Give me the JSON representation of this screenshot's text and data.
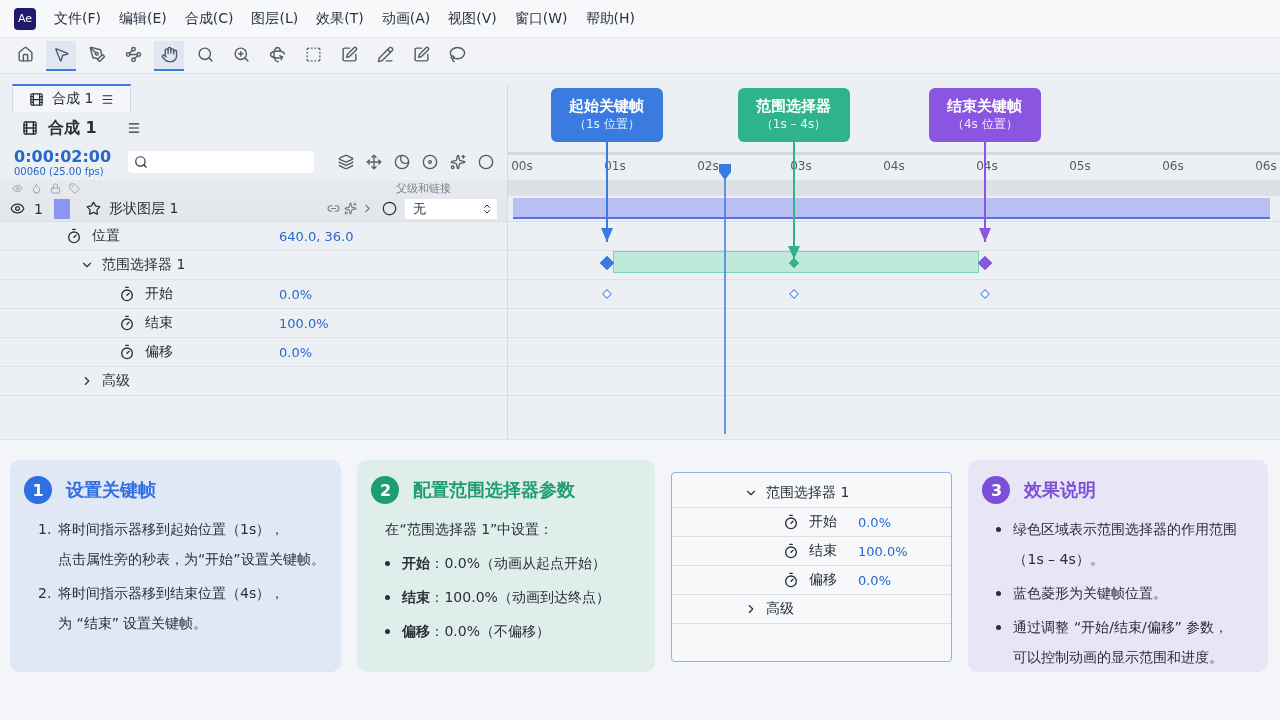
{
  "menu_bar": {
    "logo": "Ae",
    "items": [
      "文件(F)",
      "编辑(E)",
      "合成(C)",
      "图层(L)",
      "效果(T)",
      "动画(A)",
      "视图(V)",
      "窗口(W)",
      "帮助(H)"
    ]
  },
  "toolbar": {
    "tools": [
      {
        "selected": false
      },
      {
        "selected": true
      },
      {
        "selected": false
      },
      {
        "selected": false
      },
      {
        "selected": true
      },
      {
        "selected": false
      },
      {
        "selected": false
      },
      {
        "selected": false
      },
      {
        "selected": false
      },
      {
        "selected": false
      },
      {
        "selected": false
      },
      {
        "selected": false
      },
      {
        "selected": false
      }
    ]
  },
  "panel_tab": {
    "label": "合成 1",
    "selected": true
  },
  "composition": {
    "name": "合成 1",
    "timecode": "0:00:02:00",
    "frame_info": "00060 (25.00 fps)"
  },
  "layer_columns": {
    "parent": "父级和链接"
  },
  "layers": [
    {
      "number": "1",
      "name": "形状图层 1",
      "color": "#8c95f2",
      "parent": "无",
      "visible": true
    }
  ],
  "properties": [
    {
      "kind": "property",
      "name": "位置",
      "value": "640.0, 36.0"
    },
    {
      "kind": "group",
      "name": "范围选择器 1",
      "expanded": true,
      "children": [
        {
          "kind": "property",
          "name": "开始",
          "value": "0.0%"
        },
        {
          "kind": "property",
          "name": "结束",
          "value": "100.0%"
        },
        {
          "kind": "property",
          "name": "偏移",
          "value": "0.0%"
        }
      ]
    },
    {
      "kind": "group",
      "name": "高级",
      "expanded": false
    }
  ],
  "timeline": {
    "ruler": [
      "00s",
      "01s",
      "02s",
      "03s",
      "04s",
      "04s",
      "05s",
      "06s",
      "06s"
    ],
    "playhead": {
      "level": 0.273
    },
    "callouts": [
      {
        "title": "起始关键帧",
        "subtitle": "（1s 位置）",
        "color": "#3a7be0",
        "level": 0.114
      },
      {
        "title": "范围选择器",
        "subtitle": "（1s – 4s）",
        "color": "#2fb38a",
        "level": 0.365
      },
      {
        "title": "结束关键帧",
        "subtitle": "（4s 位置）",
        "color": "#8a55e0",
        "level": 0.622
      }
    ]
  },
  "cards": [
    {
      "kind": "numbered",
      "number": "1",
      "title": "设置关键帧",
      "color": "#2f6fdf",
      "items": [
        {
          "marker": "1.",
          "lines": [
            "将时间指示器移到起始位置（1s），",
            "点击属性旁的秒表，为“开始”设置关键帧。"
          ]
        },
        {
          "marker": "2.",
          "lines": [
            "将时间指示器移到结束位置（4s），",
            "为 “结束” 设置关键帧。"
          ]
        }
      ]
    },
    {
      "kind": "bulleted",
      "number": "2",
      "title": "配置范围选择器参数",
      "color": "#1f9d72",
      "intro": "在“范围选择器 1”中设置：",
      "items": [
        {
          "lines": [
            "**开始**：0.0%（动画从起点开始）"
          ]
        },
        {
          "lines": [
            "**结束**：100.0%（动画到达终点）"
          ]
        },
        {
          "lines": [
            "**偏移**：0.0%（不偏移）"
          ]
        }
      ]
    },
    {
      "kind": "properties",
      "properties": [
        {
          "kind": "group",
          "name": "范围选择器 1",
          "expanded": true,
          "children": [
            {
              "kind": "property",
              "name": "开始",
              "value": "0.0%"
            },
            {
              "kind": "property",
              "name": "结束",
              "value": "100.0%"
            },
            {
              "kind": "property",
              "name": "偏移",
              "value": "0.0%"
            }
          ]
        },
        {
          "kind": "group",
          "name": "高级",
          "expanded": false
        }
      ]
    },
    {
      "kind": "bulleted",
      "number": "3",
      "title": "效果说明",
      "color": "#7c4fd8",
      "items": [
        {
          "lines": [
            "绿色区域表示范围选择器的作用范围",
            "（1s – 4s）。"
          ]
        },
        {
          "lines": [
            "蓝色菱形为关键帧位置。"
          ]
        },
        {
          "lines": [
            "通过调整 “开始/结束/偏移” 参数，",
            "可以控制动画的显示范围和进度。"
          ]
        }
      ]
    }
  ]
}
